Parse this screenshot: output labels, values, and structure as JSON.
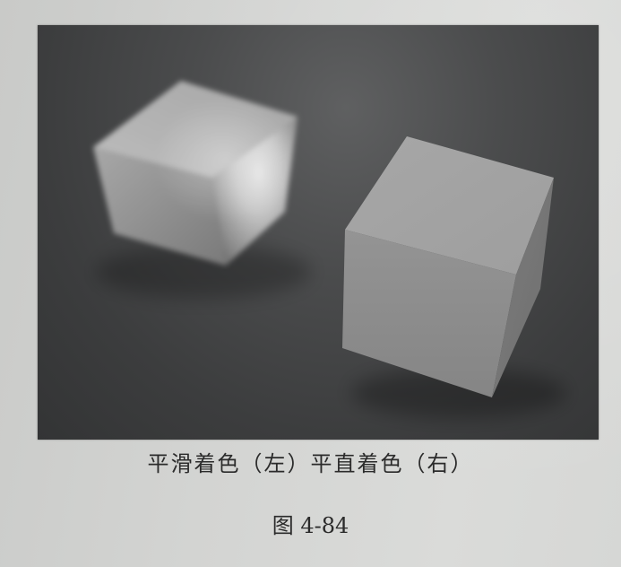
{
  "figure": {
    "caption": "平滑着色（左）平直着色（右）",
    "number_label": "图 4-84"
  },
  "scene": {
    "objects": [
      {
        "name": "smooth-shaded-cube",
        "shading": "smooth"
      },
      {
        "name": "flat-shaded-cube",
        "shading": "flat"
      }
    ],
    "colors": {
      "background_dark": "#333435",
      "background_light": "#5f6061",
      "cube_highlight": "#d8d8d8",
      "cube_face_light": "#a9a9a9",
      "cube_face_mid": "#8e8e8e"
    }
  }
}
